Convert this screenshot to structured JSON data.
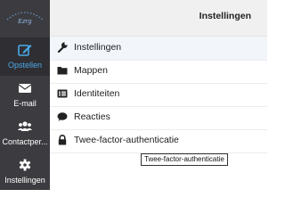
{
  "sidebar": {
    "logo_text": "Ezrg",
    "items": [
      {
        "label": "Opstellen",
        "icon": "compose-icon",
        "active": true
      },
      {
        "label": "E-mail",
        "icon": "envelope-icon",
        "active": false
      },
      {
        "label": "Contactper...",
        "icon": "users-icon",
        "active": false
      },
      {
        "label": "Instellingen",
        "icon": "gear-icon",
        "active": false
      }
    ]
  },
  "header": {
    "title": "Instellingen"
  },
  "settings_menu": {
    "items": [
      {
        "label": "Instellingen",
        "icon": "wrench-icon"
      },
      {
        "label": "Mappen",
        "icon": "folder-icon"
      },
      {
        "label": "Identiteiten",
        "icon": "id-card-icon"
      },
      {
        "label": "Reacties",
        "icon": "comment-icon"
      },
      {
        "label": "Twee-factor-authenticatie",
        "icon": "lock-icon"
      }
    ]
  },
  "tooltip": {
    "text": "Twee-factor-authenticatie"
  },
  "colors": {
    "sidebar_bg": "#3c3c40",
    "accent": "#4aa8e8",
    "header_bg": "#f0f0f0"
  }
}
